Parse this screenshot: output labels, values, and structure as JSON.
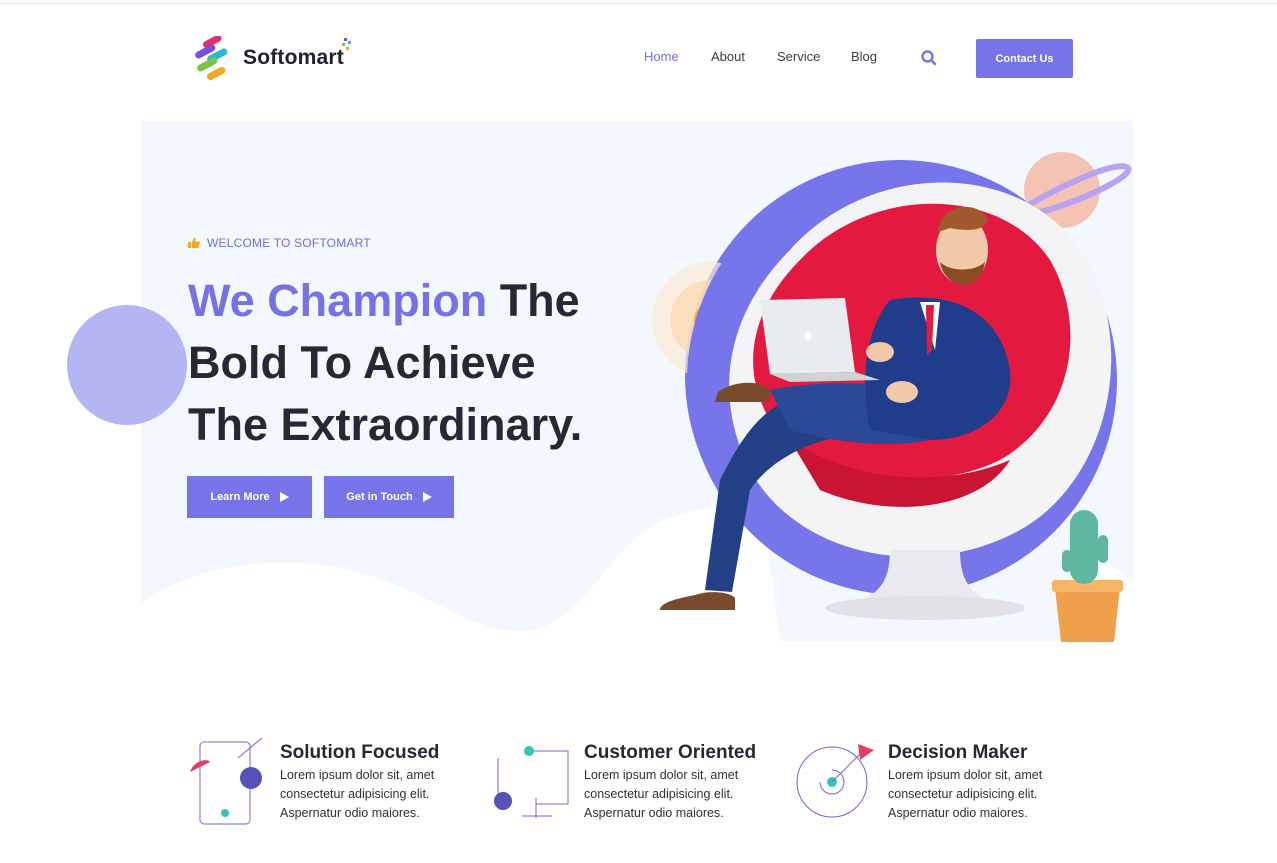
{
  "brand": {
    "name": "Softomart",
    "accent": "#7674e8"
  },
  "nav": {
    "items": [
      "Home",
      "About",
      "Service",
      "Blog"
    ],
    "active": "Home",
    "search_icon": "search-icon",
    "contact_label": "Contact Us"
  },
  "hero": {
    "welcome": "WELCOME TO SOFTOMART",
    "headline_accent": "We Champion",
    "headline_rest": " The Bold To Achieve The Extraordinary.",
    "buttons": {
      "learn_more": "Learn More",
      "get_in_touch": "Get in Touch"
    }
  },
  "features": [
    {
      "title": "Solution Focused",
      "desc": "Lorem ipsum dolor sit, amet consectetur adipisicing elit. Aspernatur odio maiores."
    },
    {
      "title": "Customer Oriented",
      "desc": "Lorem ipsum dolor sit, amet consectetur adipisicing elit. Aspernatur odio maiores."
    },
    {
      "title": "Decision Maker",
      "desc": "Lorem ipsum dolor sit, amet consectetur adipisicing elit. Aspernatur odio maiores."
    }
  ]
}
